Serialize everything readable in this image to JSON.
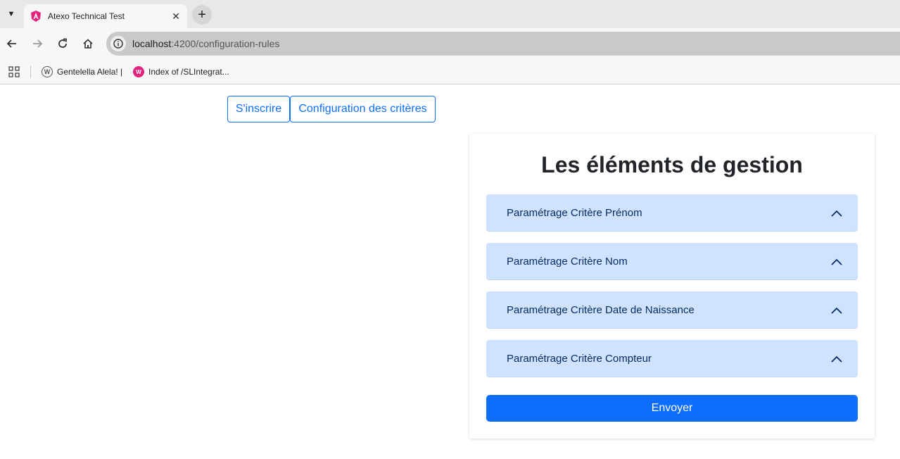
{
  "browser": {
    "tab_title": "Atexo Technical Test",
    "url_host": "localhost",
    "url_path": ":4200/configuration-rules",
    "bookmarks": [
      {
        "label": "Gentelella Alela! |"
      },
      {
        "label": "Index of /SLIntegrat..."
      }
    ]
  },
  "nav": {
    "register_label": "S'inscrire",
    "config_label": "Configuration des critères"
  },
  "card": {
    "title": "Les éléments de gestion",
    "accordion": [
      {
        "label": "Paramétrage Critère Prénom"
      },
      {
        "label": "Paramétrage Critère Nom"
      },
      {
        "label": "Paramétrage Critère Date de Naissance"
      },
      {
        "label": "Paramétrage Critère Compteur"
      }
    ],
    "submit_label": "Envoyer"
  },
  "colors": {
    "primary": "#0d6efd",
    "accordion_bg": "#cfe2ff",
    "accordion_text": "#052c65"
  }
}
